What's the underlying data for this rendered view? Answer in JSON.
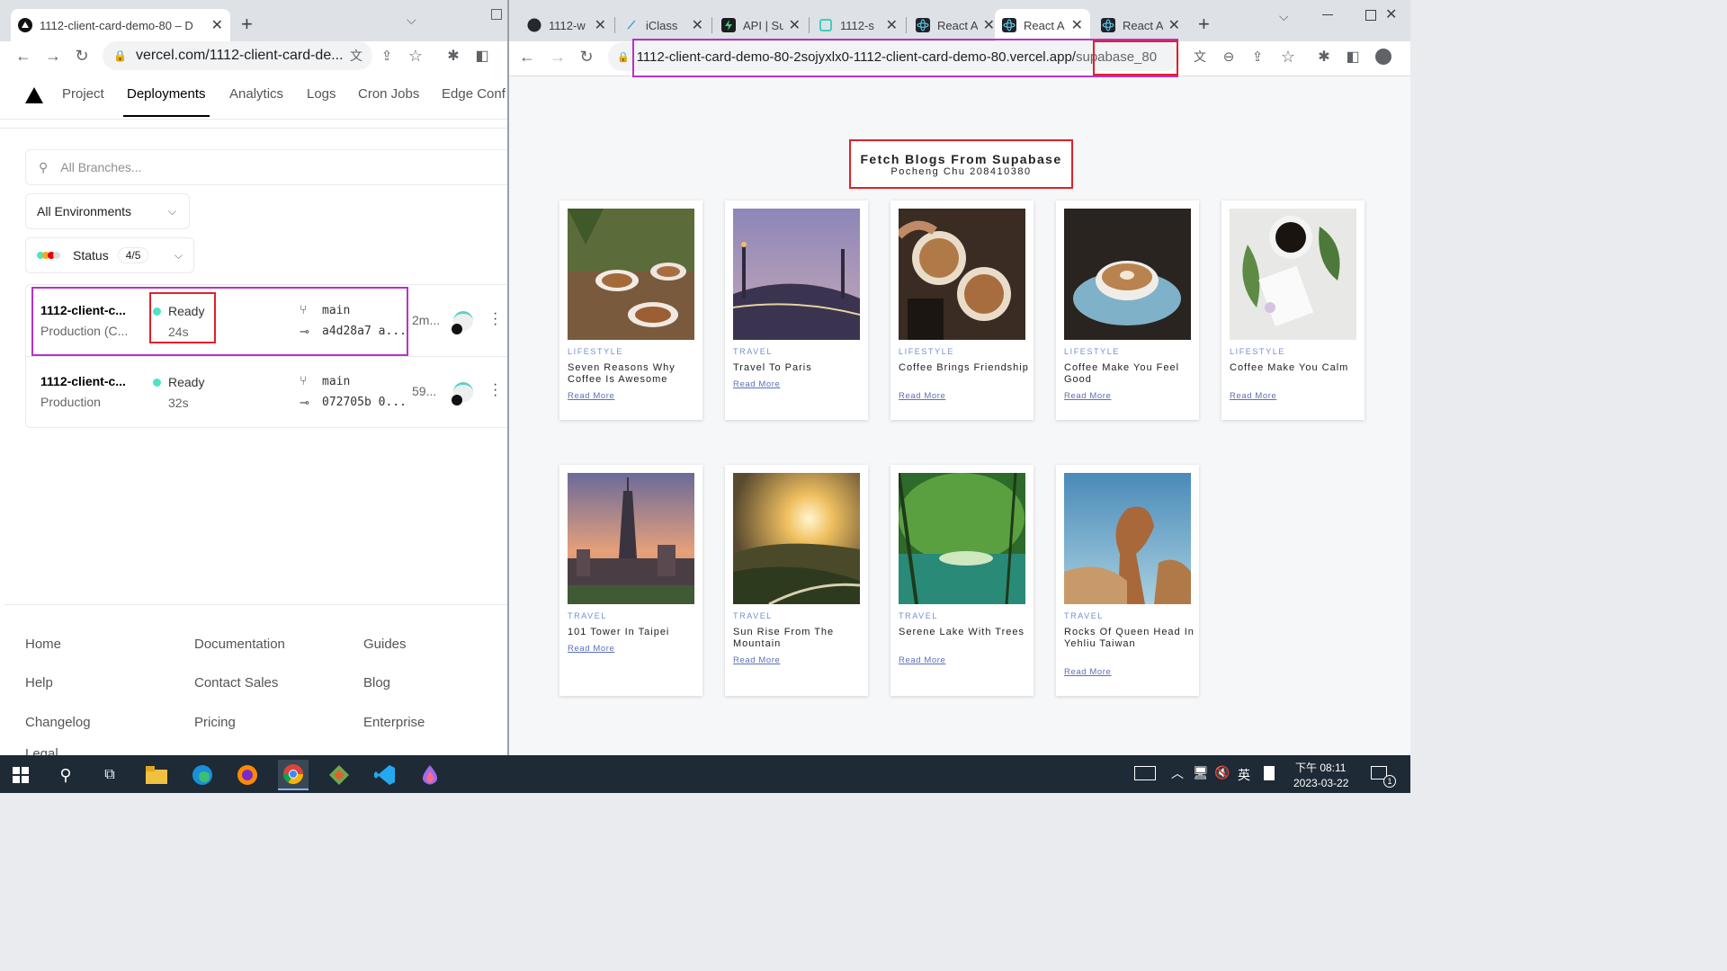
{
  "left_window": {
    "tab_title": "1112-client-card-demo-80 – D",
    "url": "vercel.com/1112-client-card-de...",
    "nav": [
      "Project",
      "Deployments",
      "Analytics",
      "Logs",
      "Cron Jobs",
      "Edge Conf"
    ],
    "active_nav": "Deployments",
    "branch_search_placeholder": "All Branches...",
    "environments_label": "All Environments",
    "status_label": "Status",
    "status_count": "4/5",
    "deployments": [
      {
        "name": "1112-client-c...",
        "env": "Production (C...",
        "status": "Ready",
        "duration": "24s",
        "branch": "main",
        "commit": "a4d28a7 a...",
        "age": "2m..."
      },
      {
        "name": "1112-client-c...",
        "env": "Production",
        "status": "Ready",
        "duration": "32s",
        "branch": "main",
        "commit": "072705b 0...",
        "age": "59..."
      }
    ],
    "footer_links": [
      [
        "Home",
        "Documentation",
        "Guides"
      ],
      [
        "Help",
        "Contact Sales",
        "Blog"
      ],
      [
        "Changelog",
        "Pricing",
        "Enterprise"
      ]
    ],
    "footer_cut": "Legal"
  },
  "right_window": {
    "tabs": [
      {
        "label": "1112-w",
        "icon": "github-icon"
      },
      {
        "label": "iClass",
        "icon": "iclass-icon"
      },
      {
        "label": "API | Su",
        "icon": "supabase-icon"
      },
      {
        "label": "1112-s",
        "icon": "page-icon"
      },
      {
        "label": "React A",
        "icon": "react-icon"
      },
      {
        "label": "React A",
        "icon": "react-icon",
        "active": true
      },
      {
        "label": "React A",
        "icon": "react-icon"
      }
    ],
    "url_main": "1112-client-card-demo-80-2sojyxlx0-1112-client-card-demo-80.vercel.app/",
    "url_path": "supabase_80",
    "heading": "Fetch Blogs From Supabase",
    "subheading": "Pocheng Chu 208410380",
    "read_more": "Read More",
    "blogs": [
      {
        "category": "LIFESTYLE",
        "title": "Seven Reasons Why Coffee Is Awesome",
        "image": "coffee-cups-photo"
      },
      {
        "category": "TRAVEL",
        "title": "Travel To Paris",
        "image": "paris-bridge-photo"
      },
      {
        "category": "LIFESTYLE",
        "title": "Coffee Brings Friendship",
        "image": "latte-art-photo"
      },
      {
        "category": "LIFESTYLE",
        "title": "Coffee Make You Feel Good",
        "image": "blue-cup-photo"
      },
      {
        "category": "LIFESTYLE",
        "title": "Coffee Make You Calm",
        "image": "coffee-leaves-photo"
      },
      {
        "category": "TRAVEL",
        "title": "101 Tower In Taipei",
        "image": "taipei-101-photo"
      },
      {
        "category": "TRAVEL",
        "title": "Sun Rise From The Mountain",
        "image": "sunrise-mountain-photo"
      },
      {
        "category": "TRAVEL",
        "title": "Serene Lake With Trees",
        "image": "green-lake-photo"
      },
      {
        "category": "TRAVEL",
        "title": "Rocks Of Queen Head In Yehliu Taiwan",
        "image": "yehliu-rock-photo"
      }
    ]
  },
  "taskbar": {
    "ime": "英",
    "time": "下午 08:11",
    "date": "2023-03-22",
    "notification_count": "1"
  },
  "colors": {
    "highlight_purple": "#b832c8",
    "highlight_red": "#e0202a",
    "ready_green": "#50e3c2",
    "taskbar_bg": "#1e2a36"
  }
}
